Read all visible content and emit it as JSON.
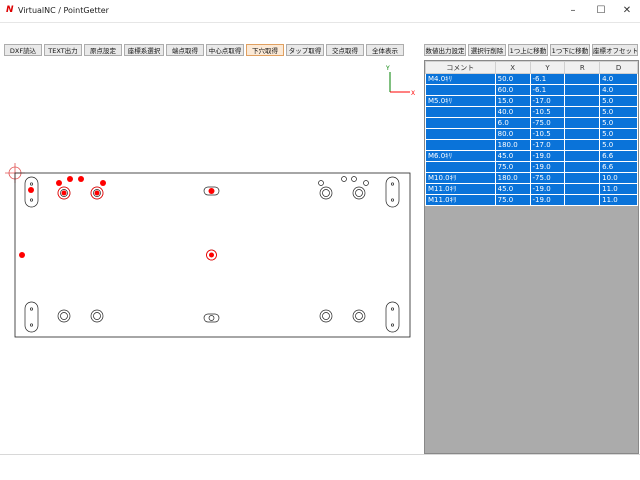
{
  "window": {
    "title": "VirtualNC / PointGetter",
    "controls": [
      "–",
      "☐",
      "✕"
    ]
  },
  "toolbar": {
    "left": [
      "DXF読込",
      "TEXT出力",
      "原点設定",
      "座標系選択",
      "端点取得",
      "中心点取得",
      "下穴取得",
      "タップ取得",
      "交点取得",
      "全体表示"
    ],
    "right": [
      "数値出力設定",
      "選択行削除",
      "1つ上に移動",
      "1つ下に移動",
      "座標オフセット"
    ]
  },
  "axis": {
    "x_label": "X",
    "y_label": "Y"
  },
  "table": {
    "headers": [
      "コメント",
      "X",
      "Y",
      "R",
      "D"
    ],
    "rows": [
      [
        "M4.0ｷﾘ",
        "50.0",
        "-6.1",
        "",
        "4.0"
      ],
      [
        "",
        "60.0",
        "-6.1",
        "",
        "4.0"
      ],
      [
        "M5.0ｷﾘ",
        "15.0",
        "-17.0",
        "",
        "5.0"
      ],
      [
        "",
        "40.0",
        "-10.5",
        "",
        "5.0"
      ],
      [
        "",
        "6.0",
        "-75.0",
        "",
        "5.0"
      ],
      [
        "",
        "80.0",
        "-10.5",
        "",
        "5.0"
      ],
      [
        "",
        "180.0",
        "-17.0",
        "",
        "5.0"
      ],
      [
        "M6.0ｷﾘ",
        "45.0",
        "-19.0",
        "",
        "6.6"
      ],
      [
        "",
        "75.0",
        "-19.0",
        "",
        "6.6"
      ],
      [
        "M10.0ｷﾘ",
        "180.0",
        "-75.0",
        "",
        "10.0"
      ],
      [
        "M11.0ｷﾘ",
        "45.0",
        "-19.0",
        "",
        "11.0"
      ],
      [
        "M11.0ｷﾘ",
        "75.0",
        "-19.0",
        "",
        "11.0"
      ]
    ]
  },
  "colors": {
    "selected_row": "#0a73d9",
    "point": "#ff0000",
    "axis_x": "#ff0000",
    "axis_y": "#008000"
  }
}
